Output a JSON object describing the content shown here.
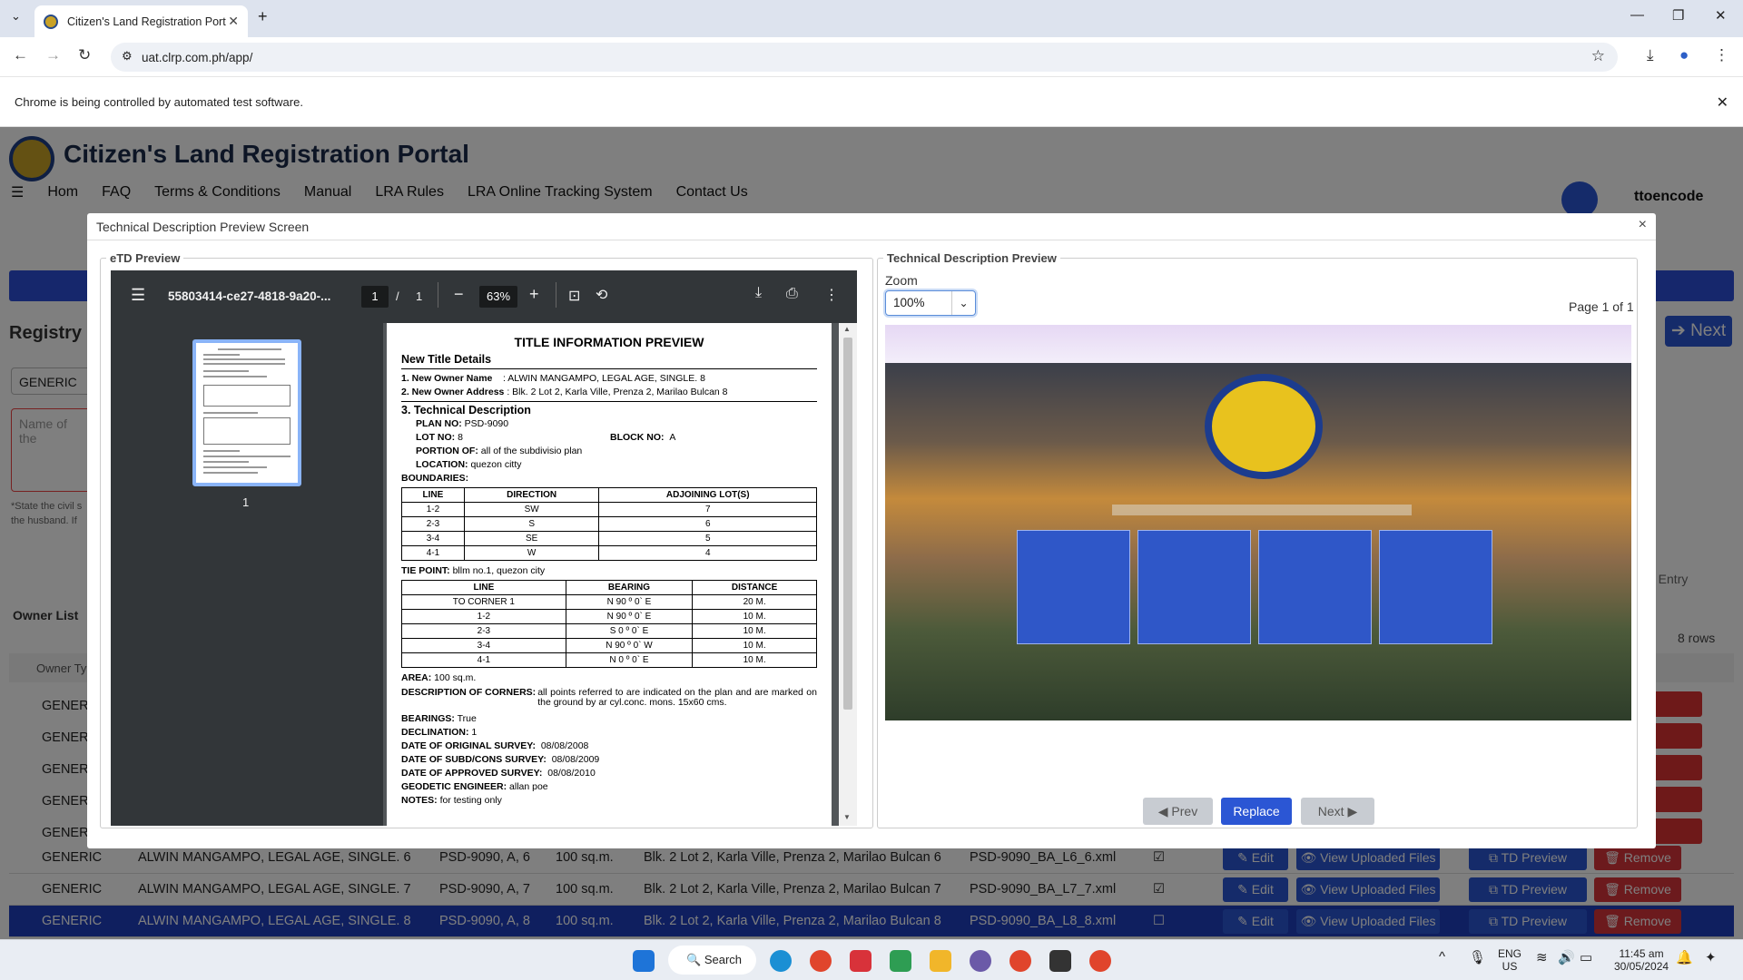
{
  "browser": {
    "tab_title": "Citizen's Land Registration Port",
    "url": "uat.clrp.com.ph/app/",
    "infobar": "Chrome is being controlled by automated test software."
  },
  "page": {
    "title": "Citizen's Land Registration Portal",
    "menu": [
      "Hom",
      "FAQ",
      "Terms & Conditions",
      "Manual",
      "LRA Rules",
      "LRA Online Tracking System",
      "Contact Us"
    ],
    "user": "ttoencode",
    "registry_heading": "Registry",
    "next_label": "Next",
    "owner_type_value": "GENERIC",
    "name_placeholder": "Name of the",
    "hint_line1": "*State the civil s",
    "hint_line2": "the husband. If",
    "owner_list_label": "Owner List",
    "add_entry_label": "d Entry",
    "rows_count": "8 rows",
    "owner_type_header": "Owner Ty",
    "generic": "GENERIC",
    "rows": [
      {
        "type": "GENERIC",
        "name": "ALWIN MANGAMPO, LEGAL AGE, SINGLE. 6",
        "plan": "PSD-9090, A, 6",
        "area": "100 sq.m.",
        "address": "Blk. 2 Lot 2, Karla Ville, Prenza 2, Marilao Bulcan 6",
        "file": "PSD-9090_BA_L6_6.xml",
        "check": "☑"
      },
      {
        "type": "GENERIC",
        "name": "ALWIN MANGAMPO, LEGAL AGE, SINGLE. 7",
        "plan": "PSD-9090, A, 7",
        "area": "100 sq.m.",
        "address": "Blk. 2 Lot 2, Karla Ville, Prenza 2, Marilao Bulcan 7",
        "file": "PSD-9090_BA_L7_7.xml",
        "check": "☑"
      },
      {
        "type": "GENERIC",
        "name": "ALWIN MANGAMPO, LEGAL AGE, SINGLE. 8",
        "plan": "PSD-9090, A, 8",
        "area": "100 sq.m.",
        "address": "Blk. 2 Lot 2, Karla Ville, Prenza 2, Marilao Bulcan 8",
        "file": "PSD-9090_BA_L8_8.xml",
        "check": "☐"
      }
    ],
    "row_buttons": {
      "edit": "✎ Edit",
      "view": "👁 View Uploaded Files",
      "td": "⧉ TD Preview",
      "remove": "🗑 Remove"
    }
  },
  "modal": {
    "title": "Technical Description Preview Screen",
    "close": "×",
    "left_legend": "eTD Preview",
    "right_legend": "Technical Description Preview",
    "pdf": {
      "filename": "55803414-ce27-4818-9a20-...",
      "page_current": "1",
      "page_sep": "/",
      "page_total": "1",
      "zoom": "63%",
      "thumb_label": "1"
    },
    "doc": {
      "title": "TITLE INFORMATION PREVIEW",
      "section1": "New Title Details",
      "owner_name_label": "1. New Owner Name",
      "owner_name_value": ": ALWIN MANGAMPO, LEGAL AGE, SINGLE. 8",
      "owner_addr_label": "2. New Owner Address",
      "owner_addr_value": ": Blk. 2 Lot 2, Karla Ville, Prenza 2, Marilao Bulcan 8",
      "section3": "3. Technical Description",
      "plan_no_label": "PLAN NO:",
      "plan_no": "PSD-9090",
      "lot_no_label": "LOT NO:",
      "lot_no": "8",
      "block_no_label": "BLOCK NO:",
      "block_no": "A",
      "portion_label": "PORTION OF:",
      "portion": "all of the subdivisio plan",
      "location_label": "LOCATION:",
      "location": "quezon citty",
      "boundaries_label": "BOUNDARIES:",
      "bound_headers": [
        "LINE",
        "DIRECTION",
        "ADJOINING LOT(S)"
      ],
      "bound_rows": [
        [
          "1-2",
          "SW",
          "7"
        ],
        [
          "2-3",
          "S",
          "6"
        ],
        [
          "3-4",
          "SE",
          "5"
        ],
        [
          "4-1",
          "W",
          "4"
        ]
      ],
      "tie_label": "TIE POINT:",
      "tie": "bllm no.1, quezon city",
      "bear_headers": [
        "LINE",
        "BEARING",
        "DISTANCE"
      ],
      "bear_rows": [
        [
          "TO CORNER 1",
          "N 90 º 0` E",
          "20 M."
        ],
        [
          "1-2",
          "N 90 º 0` E",
          "10 M."
        ],
        [
          "2-3",
          "S 0 º 0` E",
          "10 M."
        ],
        [
          "3-4",
          "N 90 º 0` W",
          "10 M."
        ],
        [
          "4-1",
          "N 0 º 0` E",
          "10 M."
        ]
      ],
      "area_label": "AREA:",
      "area": "100 sq.m.",
      "corners_label": "DESCRIPTION OF CORNERS:",
      "corners": "all points referred to are indicated on the plan and are marked on the ground by ar cyl.conc. mons. 15x60 cms.",
      "bearings_label": "BEARINGS:",
      "bearings": "True",
      "declination_label": "DECLINATION:",
      "declination": "1",
      "orig_label": "DATE OF ORIGINAL SURVEY:",
      "orig": "08/08/2008",
      "subd_label": "DATE OF SUBD/CONS SURVEY:",
      "subd": "08/08/2009",
      "appr_label": "DATE OF APPROVED SURVEY:",
      "appr": "08/08/2010",
      "geo_label": "GEODETIC ENGINEER:",
      "geo": "allan poe",
      "notes_label": "NOTES:",
      "notes": "for testing only"
    },
    "zoom_label": "Zoom",
    "zoom_value": "100%",
    "page_of": "Page 1 of 1",
    "prev": "Prev",
    "replace": "Replace",
    "next": "Next"
  },
  "taskbar": {
    "search": "Search",
    "lang1": "ENG",
    "lang2": "US",
    "time": "11:45 am",
    "date": "30/05/2024"
  },
  "colors": {
    "primary": "#2b56d4",
    "danger": "#d9343b",
    "pdf_bar": "#323639"
  }
}
